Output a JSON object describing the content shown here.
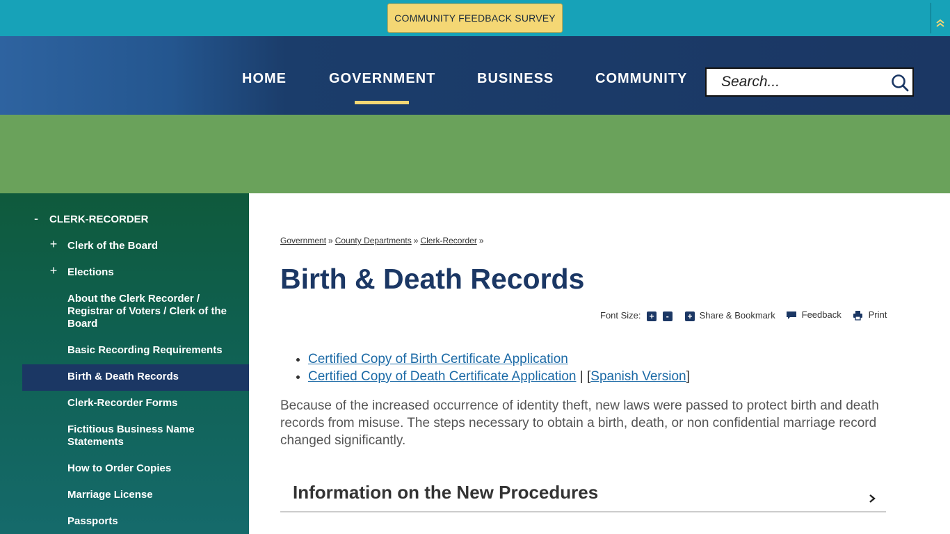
{
  "alert": {
    "survey_label": "COMMUNITY FEEDBACK SURVEY",
    "collapse_icon": "double-chevron-up-icon"
  },
  "nav": {
    "items": [
      {
        "label": "HOME"
      },
      {
        "label": "GOVERNMENT"
      },
      {
        "label": "BUSINESS"
      },
      {
        "label": "COMMUNITY"
      }
    ],
    "active": "GOVERNMENT"
  },
  "search": {
    "placeholder": "Search...",
    "icon": "search-icon"
  },
  "sidebar": {
    "items": [
      {
        "label": "CLERK-RECORDER",
        "sign": "-"
      },
      {
        "label": "Clerk of the Board",
        "sign": "+"
      },
      {
        "label": "Elections",
        "sign": "+"
      },
      {
        "label": "About the Clerk Recorder / Registrar of Voters / Clerk of the Board",
        "sign": ""
      },
      {
        "label": "Basic Recording Requirements",
        "sign": ""
      },
      {
        "label": "Birth & Death Records",
        "sign": ""
      },
      {
        "label": "Clerk-Recorder Forms",
        "sign": ""
      },
      {
        "label": "Fictitious Business Name Statements",
        "sign": ""
      },
      {
        "label": "How to Order Copies",
        "sign": ""
      },
      {
        "label": "Marriage License",
        "sign": ""
      },
      {
        "label": "Passports",
        "sign": ""
      }
    ],
    "active": "Birth & Death Records"
  },
  "breadcrumb": {
    "items": [
      "Government",
      "County Departments",
      "Clerk-Recorder"
    ],
    "separator": "»"
  },
  "page": {
    "title": "Birth & Death Records"
  },
  "tools": {
    "font_size_label": "Font Size:",
    "increase": "+",
    "decrease": "-",
    "share_label": "Share & Bookmark",
    "feedback_label": "Feedback",
    "print_label": "Print"
  },
  "links": {
    "birth": "Certified Copy of Birth Certificate Application",
    "death": "Certified Copy of Death Certificate Application",
    "divider": "| [",
    "spanish": "Spanish Version",
    "close": "]"
  },
  "body_text": "Because of the increased occurrence of identity theft, new laws were passed to protect birth and death records from misuse. The steps necessary to obtain a birth, death, or non confidential marriage record changed significantly.",
  "accordion": {
    "title": "Information on the New Procedures"
  },
  "colors": {
    "alert_bar": "#17a2b8",
    "survey_button": "#f4d774",
    "header_navy": "#1b3764",
    "banner_green": "#6aa25b",
    "link_blue": "#1c6aa6"
  }
}
